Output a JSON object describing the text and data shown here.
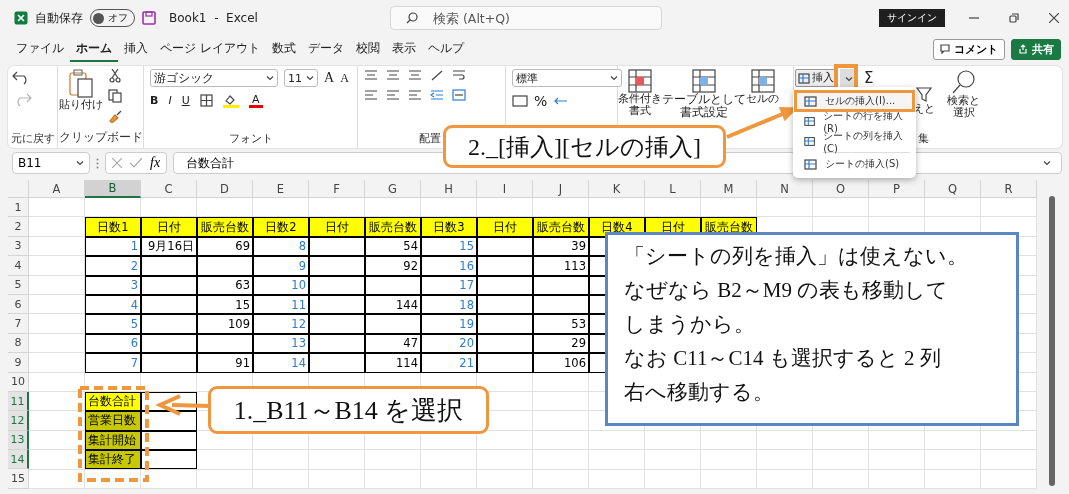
{
  "title_bar": {
    "autosave_label": "自動保存",
    "autosave_toggle": {
      "label": "オフ",
      "on": false
    },
    "document_title": "Book1  -  Excel",
    "search": {
      "placeholder": "検索 (Alt+Q)"
    },
    "sign_in": "サインイン"
  },
  "menu_tabs": [
    {
      "label": "ファイル",
      "selected": false
    },
    {
      "label": "ホーム",
      "selected": true
    },
    {
      "label": "挿入",
      "selected": false
    },
    {
      "label": "ページ レイアウト",
      "selected": false
    },
    {
      "label": "数式",
      "selected": false
    },
    {
      "label": "データ",
      "selected": false
    },
    {
      "label": "校閲",
      "selected": false
    },
    {
      "label": "表示",
      "selected": false
    },
    {
      "label": "ヘルプ",
      "selected": false
    }
  ],
  "comment_button": "コメント",
  "share_button": "共有",
  "ribbon": {
    "undo": {
      "group_label": "元に戻す"
    },
    "clipboard": {
      "paste_label": "貼り付け",
      "group_label": "クリップボード"
    },
    "font": {
      "font_name": "游ゴシック",
      "font_size": "11",
      "grow": "A",
      "shrink": "A",
      "bold": "B",
      "italic": "I",
      "underline": "U",
      "font_color": "A",
      "group_label": "フォント"
    },
    "alignment": {
      "group_label": "配置"
    },
    "number": {
      "format": "標準",
      "percent": "%"
    },
    "styles": [
      {
        "line1": "条件付き",
        "line2": "書式"
      },
      {
        "line1": "テーブルとして",
        "line2": "書式設定"
      },
      {
        "line1": "セルの"
      }
    ],
    "cells": {
      "insert_label": "挿入"
    },
    "editing": {
      "sum": "Σ",
      "sort_filter": "えと",
      "find_select_line1": "検索と",
      "find_select_line2": "選択",
      "group_label": "集"
    }
  },
  "formula_bar": {
    "name_box": "B11",
    "fx": "fx",
    "formula": "台数合計"
  },
  "insert_menu": [
    {
      "label": "セルの挿入(I)...",
      "selected": true
    },
    {
      "label": "シートの行を挿入(R)",
      "selected": false
    },
    {
      "label": "シートの列を挿入(C)",
      "selected": false
    },
    {
      "label": "シートの挿入(S)",
      "selected": false
    }
  ],
  "sheet": {
    "columns": [
      {
        "label": "A",
        "selected": false
      },
      {
        "label": "B",
        "selected": true
      },
      {
        "label": "C",
        "selected": false
      },
      {
        "label": "D",
        "selected": false
      },
      {
        "label": "E",
        "selected": false
      },
      {
        "label": "F",
        "selected": false
      },
      {
        "label": "G",
        "selected": false
      },
      {
        "label": "H",
        "selected": false
      },
      {
        "label": "I",
        "selected": false
      },
      {
        "label": "J",
        "selected": false
      },
      {
        "label": "K",
        "selected": false
      },
      {
        "label": "L",
        "selected": false
      },
      {
        "label": "M",
        "selected": false
      },
      {
        "label": "N",
        "selected": false
      },
      {
        "label": "O",
        "selected": false
      },
      {
        "label": "P",
        "selected": false
      },
      {
        "label": "Q",
        "selected": false
      },
      {
        "label": "R",
        "selected": false
      }
    ],
    "rows": [
      {
        "label": "1",
        "selected": false,
        "cells": []
      },
      {
        "label": "2",
        "selected": false,
        "cells": [
          null,
          {
            "kind": "header",
            "text": "日数1"
          },
          {
            "kind": "header",
            "text": "日付"
          },
          {
            "kind": "header",
            "text": "販売台数"
          },
          {
            "kind": "header",
            "text": "日数2"
          },
          {
            "kind": "header",
            "text": "日付"
          },
          {
            "kind": "header",
            "text": "販売台数"
          },
          {
            "kind": "header",
            "text": "日数3"
          },
          {
            "kind": "header",
            "text": "日付"
          },
          {
            "kind": "header",
            "text": "販売台数"
          },
          {
            "kind": "header",
            "text": "日数4"
          },
          {
            "kind": "header",
            "text": "日付"
          },
          {
            "kind": "header",
            "text": "販売台数"
          }
        ]
      },
      {
        "label": "3",
        "selected": false,
        "cells": [
          null,
          {
            "kind": "day",
            "text": "1"
          },
          {
            "kind": "value",
            "text": "9月16日"
          },
          {
            "kind": "value",
            "text": "69"
          },
          {
            "kind": "day",
            "text": "8"
          },
          {
            "kind": "boxed"
          },
          {
            "kind": "value",
            "text": "54"
          },
          {
            "kind": "day",
            "text": "15"
          },
          {
            "kind": "boxed"
          },
          {
            "kind": "value",
            "text": "39"
          },
          {
            "kind": "boxed"
          },
          {
            "kind": "boxed"
          },
          {
            "kind": "boxed"
          }
        ]
      },
      {
        "label": "4",
        "selected": false,
        "cells": [
          null,
          {
            "kind": "day",
            "text": "2"
          },
          {
            "kind": "boxed"
          },
          {
            "kind": "boxed"
          },
          {
            "kind": "day",
            "text": "9"
          },
          {
            "kind": "boxed"
          },
          {
            "kind": "value",
            "text": "92"
          },
          {
            "kind": "day",
            "text": "16"
          },
          {
            "kind": "boxed"
          },
          {
            "kind": "value",
            "text": "113"
          },
          {
            "kind": "boxed"
          },
          {
            "kind": "boxed"
          },
          {
            "kind": "boxed"
          }
        ]
      },
      {
        "label": "5",
        "selected": false,
        "cells": [
          null,
          {
            "kind": "day",
            "text": "3"
          },
          {
            "kind": "boxed"
          },
          {
            "kind": "value",
            "text": "63"
          },
          {
            "kind": "day",
            "text": "10"
          },
          {
            "kind": "boxed"
          },
          {
            "kind": "boxed"
          },
          {
            "kind": "day",
            "text": "17"
          },
          {
            "kind": "boxed"
          },
          {
            "kind": "boxed"
          },
          {
            "kind": "boxed"
          },
          {
            "kind": "boxed"
          },
          {
            "kind": "boxed"
          }
        ]
      },
      {
        "label": "6",
        "selected": false,
        "cells": [
          null,
          {
            "kind": "day",
            "text": "4"
          },
          {
            "kind": "boxed"
          },
          {
            "kind": "value",
            "text": "15"
          },
          {
            "kind": "day",
            "text": "11"
          },
          {
            "kind": "boxed"
          },
          {
            "kind": "value",
            "text": "144"
          },
          {
            "kind": "day",
            "text": "18"
          },
          {
            "kind": "boxed"
          },
          {
            "kind": "boxed"
          },
          {
            "kind": "boxed"
          },
          {
            "kind": "boxed"
          },
          {
            "kind": "boxed"
          }
        ]
      },
      {
        "label": "7",
        "selected": false,
        "cells": [
          null,
          {
            "kind": "day",
            "text": "5"
          },
          {
            "kind": "boxed"
          },
          {
            "kind": "value",
            "text": "109"
          },
          {
            "kind": "day",
            "text": "12"
          },
          {
            "kind": "boxed"
          },
          {
            "kind": "boxed"
          },
          {
            "kind": "day",
            "text": "19"
          },
          {
            "kind": "boxed"
          },
          {
            "kind": "value",
            "text": "53"
          },
          {
            "kind": "boxed"
          },
          {
            "kind": "boxed"
          },
          {
            "kind": "boxed"
          }
        ]
      },
      {
        "label": "8",
        "selected": false,
        "cells": [
          null,
          {
            "kind": "day",
            "text": "6"
          },
          {
            "kind": "boxed"
          },
          {
            "kind": "boxed"
          },
          {
            "kind": "day",
            "text": "13"
          },
          {
            "kind": "boxed"
          },
          {
            "kind": "value",
            "text": "47"
          },
          {
            "kind": "day",
            "text": "20"
          },
          {
            "kind": "boxed"
          },
          {
            "kind": "value",
            "text": "29"
          },
          {
            "kind": "boxed"
          },
          {
            "kind": "boxed"
          },
          {
            "kind": "boxed"
          }
        ]
      },
      {
        "label": "9",
        "selected": false,
        "cells": [
          null,
          {
            "kind": "day",
            "text": "7"
          },
          {
            "kind": "boxed"
          },
          {
            "kind": "value",
            "text": "91"
          },
          {
            "kind": "day",
            "text": "14"
          },
          {
            "kind": "boxed"
          },
          {
            "kind": "value",
            "text": "114"
          },
          {
            "kind": "day",
            "text": "21"
          },
          {
            "kind": "boxed"
          },
          {
            "kind": "value",
            "text": "106"
          },
          {
            "kind": "boxed"
          },
          {
            "kind": "boxed"
          },
          {
            "kind": "boxed"
          }
        ]
      },
      {
        "label": "10",
        "selected": false,
        "cells": []
      },
      {
        "label": "11",
        "selected": true,
        "cells": [
          null,
          {
            "kind": "label",
            "text": "台数合計",
            "active": true
          },
          {
            "kind": "boxed"
          }
        ]
      },
      {
        "label": "12",
        "selected": true,
        "cells": [
          null,
          {
            "kind": "label",
            "text": "営業日数",
            "active": false
          },
          {
            "kind": "boxed"
          }
        ]
      },
      {
        "label": "13",
        "selected": true,
        "cells": [
          null,
          {
            "kind": "label",
            "text": "集計開始",
            "active": false
          },
          {
            "kind": "boxed"
          }
        ]
      },
      {
        "label": "14",
        "selected": true,
        "cells": [
          null,
          {
            "kind": "label",
            "text": "集計終了",
            "active": false
          },
          {
            "kind": "boxed"
          }
        ]
      },
      {
        "label": "15",
        "selected": false,
        "cells": []
      }
    ]
  },
  "callouts": {
    "step2": "2._[挿入][セルの挿入]",
    "step1": "1._B11～B14 を選択",
    "note": [
      "「シートの列を挿入」は使えない。",
      "なぜなら B2～M9 の表も移動して",
      "しまうから。",
      "なお C11～C14 も選択すると 2 列",
      "右へ移動する。"
    ]
  }
}
